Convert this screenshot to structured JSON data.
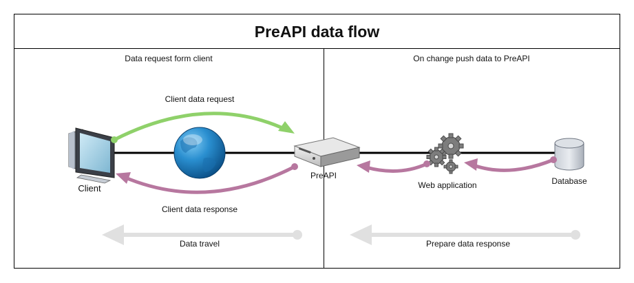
{
  "title": "PreAPI data flow",
  "sections": {
    "left": "Data request form client",
    "right": "On change push data to PreAPI"
  },
  "nodes": {
    "client": "Client",
    "preapi": "PreAPI",
    "web_application": "Web application",
    "database": "Database"
  },
  "edges": {
    "client_request": "Client data request",
    "client_response": "Client data response"
  },
  "legend": {
    "data_travel": "Data travel",
    "prepare_response": "Prepare data response"
  },
  "colors": {
    "request_arrow": "#8fd16a",
    "response_arrow": "#b7779f",
    "legend_arrow": "#e0e0e0",
    "globe": "#1f86c8",
    "border": "#000000"
  }
}
